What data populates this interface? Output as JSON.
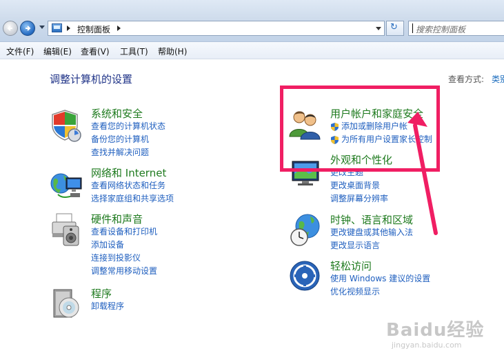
{
  "toolbar": {
    "breadcrumb_root": "控制面板",
    "search_placeholder": "搜索控制面板"
  },
  "menu": {
    "file": "文件(F)",
    "edit": "编辑(E)",
    "view": "查看(V)",
    "tools": "工具(T)",
    "help": "帮助(H)"
  },
  "main": {
    "title": "调整计算机的设置",
    "view_by_label": "查看方式:",
    "view_by_value": "类别"
  },
  "categories": {
    "system_security": {
      "title": "系统和安全",
      "links": [
        "查看您的计算机状态",
        "备份您的计算机",
        "查找并解决问题"
      ]
    },
    "network": {
      "title": "网络和 Internet",
      "links": [
        "查看网络状态和任务",
        "选择家庭组和共享选项"
      ]
    },
    "hardware": {
      "title": "硬件和声音",
      "links": [
        "查看设备和打印机",
        "添加设备",
        "连接到投影仪",
        "调整常用移动设置"
      ]
    },
    "programs": {
      "title": "程序",
      "links": [
        "卸载程序"
      ]
    },
    "user_accounts": {
      "title": "用户帐户和家庭安全",
      "links": [
        "添加或删除用户帐",
        "为所有用户设置家长控制"
      ]
    },
    "appearance": {
      "title": "外观和个性化",
      "links": [
        "更改主题",
        "更改桌面背景",
        "调整屏幕分辨率"
      ]
    },
    "clock": {
      "title": "时钟、语言和区域",
      "links": [
        "更改键盘或其他输入法",
        "更改显示语言"
      ]
    },
    "ease": {
      "title": "轻松访问",
      "links": [
        "使用 Windows 建议的设置",
        "优化视频显示"
      ]
    }
  },
  "annotation": {
    "color": "#f01e63"
  },
  "watermark": {
    "logo": "Baidu经验",
    "url": "jingyan.baidu.com"
  },
  "colors": {
    "category_title": "#1e7a1e",
    "link": "#1f5fbf",
    "heading": "#1e3287"
  }
}
